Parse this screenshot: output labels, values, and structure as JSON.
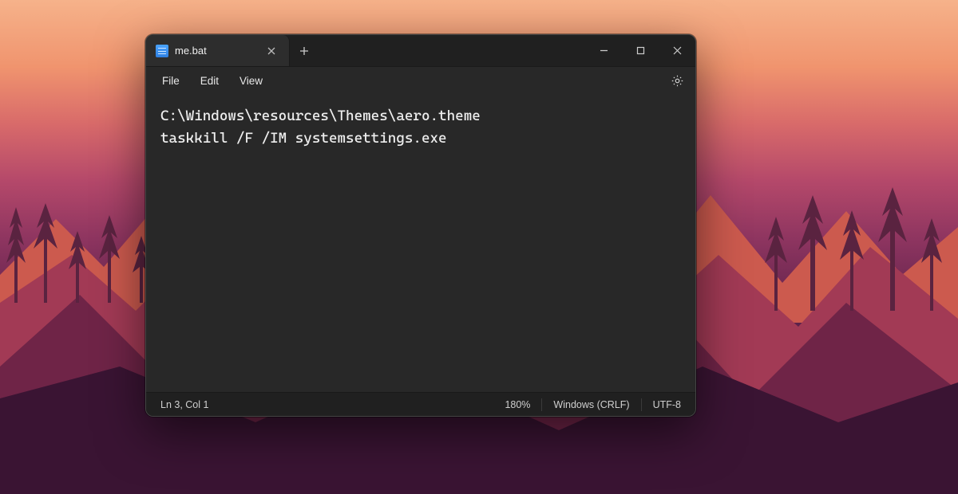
{
  "tab": {
    "title": "me.bat"
  },
  "menus": {
    "file": "File",
    "edit": "Edit",
    "view": "View"
  },
  "content": {
    "line1": "C:\\Windows\\resources\\Themes\\aero.theme",
    "line2": "taskkill /F /IM systemsettings.exe"
  },
  "status": {
    "position": "Ln 3, Col 1",
    "zoom": "180%",
    "eol": "Windows (CRLF)",
    "encoding": "UTF-8"
  },
  "icons": {
    "notepad": "notepad-file-icon",
    "close": "close-icon",
    "plus": "plus-icon",
    "minimize": "minimize-icon",
    "maximize": "maximize-icon",
    "windowClose": "window-close-icon",
    "gear": "gear-icon"
  },
  "colors": {
    "windowBg": "#282828",
    "titlebarBg": "#202020",
    "text": "#eeeeee"
  }
}
